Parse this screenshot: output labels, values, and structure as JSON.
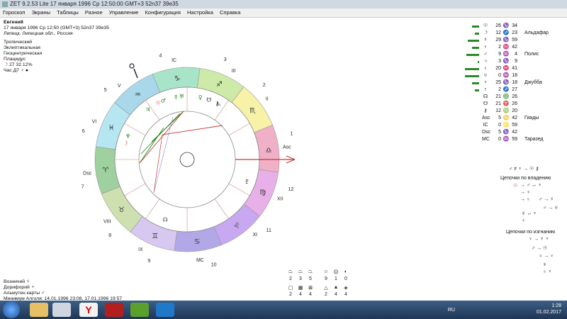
{
  "window": {
    "title": "ZET 9.2.53 Lite   17 января 1996  Ср  12:50:00 GMT+3 52n37  39e35"
  },
  "menu": [
    "Гороскоп",
    "Экраны",
    "Таблицы",
    "Разное",
    "Управление",
    "Конфигурация",
    "Настройка",
    "Справка"
  ],
  "chart_info": {
    "name": "Евгений",
    "datetime": "17 января 1996  Ср  12:50 (GMT+3)  52n37  39e35",
    "place": "Липецк, Липецкая обл., Россия",
    "zodiac": "Тропический",
    "coords": "Эклиптикальная",
    "centric": "Геоцентрическая",
    "house_system": "Плацидус",
    "moon_phase": "27 32.12%",
    "hour": "Час Д7"
  },
  "bottom_info": {
    "line1": "Возничий",
    "line2": "Дорифорий",
    "line3": "Альмутен карты",
    "line4": "Минимум Алголя: 14.01.1996 23:08,  17.01.1996 19:57"
  },
  "element_grid": {
    "col1": {
      "top": "2",
      "top2": "3",
      "top3": "5",
      "bot": "2",
      "bot2": "4",
      "bot3": "4"
    },
    "col2": {
      "top": "9",
      "top2": "1",
      "top3": "0",
      "bot": "2",
      "bot2": "4",
      "bot3": "4"
    }
  },
  "house_labels": [
    "Asc",
    "II",
    "III",
    "IC",
    "V",
    "VI",
    "Dsc",
    "VIII",
    "IX",
    "MC",
    "XI",
    "XII"
  ],
  "house_numbers": [
    "1",
    "2",
    "3",
    "4",
    "5",
    "6",
    "7",
    "8",
    "9",
    "10",
    "11",
    "12"
  ],
  "planets": [
    {
      "glyph": "☉",
      "deg": "26",
      "sign": "♑",
      "min": "34",
      "star": ""
    },
    {
      "glyph": "☽",
      "deg": "12",
      "sign": "♐",
      "min": "23",
      "star": "Альдафар"
    },
    {
      "glyph": "☿",
      "deg": "29",
      "sign": "♑",
      "min": "59",
      "star": ""
    },
    {
      "glyph": "♀",
      "deg": "2",
      "sign": "♓",
      "min": "42",
      "star": ""
    },
    {
      "glyph": "♂",
      "deg": "9",
      "sign": "♒",
      "min": "4",
      "star": "Полис"
    },
    {
      "glyph": "♃",
      "deg": "3",
      "sign": "♑",
      "min": "9",
      "star": ""
    },
    {
      "glyph": "♄",
      "deg": "20",
      "sign": "♓",
      "min": "41",
      "star": ""
    },
    {
      "glyph": "♅",
      "deg": "0",
      "sign": "♒",
      "min": "18",
      "star": ""
    },
    {
      "glyph": "♆",
      "deg": "25",
      "sign": "♑",
      "min": "18",
      "star": "Джубба"
    },
    {
      "glyph": "♇",
      "deg": "2",
      "sign": "♐",
      "min": "27",
      "star": ""
    },
    {
      "glyph": "☊",
      "deg": "21",
      "sign": "♎",
      "min": "26",
      "star": ""
    },
    {
      "glyph": "☋",
      "deg": "21",
      "sign": "♈",
      "min": "26",
      "star": ""
    },
    {
      "glyph": "⚷",
      "deg": "12",
      "sign": "♍",
      "min": "20",
      "star": ""
    },
    {
      "glyph": "Asc",
      "deg": "5",
      "sign": "♋",
      "min": "42",
      "star": "Гиады"
    },
    {
      "glyph": "IC",
      "deg": "0",
      "sign": "♌",
      "min": "59",
      "star": ""
    },
    {
      "glyph": "Dsc",
      "deg": "5",
      "sign": "♑",
      "min": "42",
      "star": ""
    },
    {
      "glyph": "MC",
      "deg": "0",
      "sign": "♒",
      "min": "59",
      "star": "Таразед"
    }
  ],
  "chains": {
    "top_formula": "♂ ≠ ♆ → ☉ ⚷",
    "ownership_title": "Цепочки по владению",
    "exile_title": "Цепочки по изгнанию"
  },
  "tray": {
    "lang": "RU",
    "time": "1:28",
    "date": "01.02.2017"
  }
}
